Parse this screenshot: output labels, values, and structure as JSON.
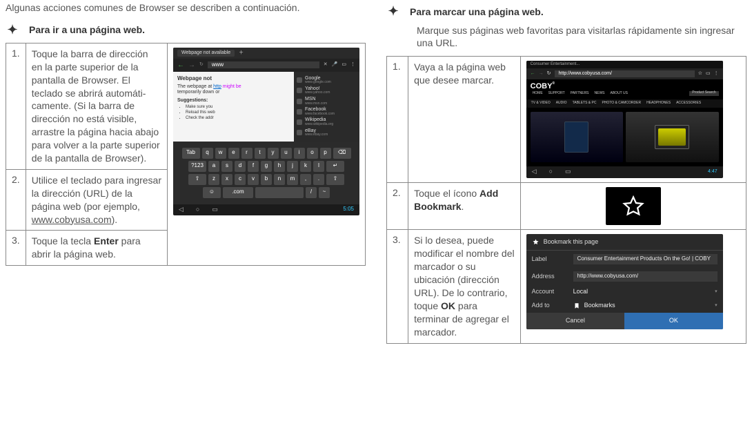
{
  "left": {
    "intro": "Algunas acciones comunes de Browser se describen a continuación.",
    "heading": "Para ir a una página web.",
    "steps": [
      {
        "num": "1.",
        "text": "Toque la barra de dirección en la parte superior de la pantalla de Browser. El teclado se abrirá automáti­camente. (Si la barra de dirección no está visible, arrastre la página hacia abajo para volver a la parte superior de la pantalla de Browser)."
      },
      {
        "num": "2.",
        "text_pre": "Utilice el teclado para ingresar la dirección (URL) de la página web (por ejemplo, ",
        "url": "www.cobyusa.com",
        "text_post": ")."
      },
      {
        "num": "3.",
        "text_pre": "Toque la tecla ",
        "bold": "Enter",
        "text_post": " para abrir la página web."
      }
    ]
  },
  "right": {
    "heading": "Para marcar una página web.",
    "subtext": "Marque sus páginas web favoritas para visitarlas rápidamente sin ingresar una URL.",
    "steps": [
      {
        "num": "1.",
        "text": "Vaya a la página web que desee marcar."
      },
      {
        "num": "2.",
        "text_pre": "Toque el ícono ",
        "bold": "Add Bookmark",
        "text_post": "."
      },
      {
        "num": "3.",
        "text_pre": "Si lo desea, puede modificar el nombre del marcador o su ubicación (direc­ción URL). De lo contrario, toque ",
        "bold": "OK",
        "text_post": " para terminar de agregar el marcador."
      }
    ]
  },
  "shot1": {
    "tab": "Webpage not available",
    "url_typed": "www",
    "page_title": "Webpage not ",
    "msg1": "The webpage at ",
    "http": "http",
    "msg2": " might be",
    "msg3": "temporarily down or",
    "sugg": "Suggestions:",
    "bul1": "Make sure you",
    "bul2": "Reload this web",
    "bul3": "Check the addr",
    "side": [
      "Google",
      "Yahoo!",
      "MSN",
      "Facebook",
      "Wikipedia",
      "eBay"
    ],
    "side_sub": [
      "www.google.com",
      "www.yahoo.com",
      "www.msn.com",
      "www.facebook.com",
      "www.wikipedia.org",
      "www.ebay.com"
    ],
    "kbd_rows": [
      [
        "Tab",
        "q",
        "w",
        "e",
        "r",
        "t",
        "y",
        "u",
        "i",
        "o",
        "p",
        "⌫"
      ],
      [
        "?123",
        "a",
        "s",
        "d",
        "f",
        "g",
        "h",
        "j",
        "k",
        "l",
        "↵"
      ],
      [
        "⇧",
        "z",
        "x",
        "c",
        "v",
        "b",
        "n",
        "m",
        ",",
        ".",
        "⇧"
      ],
      [
        "☺",
        ".com",
        "/",
        "~"
      ]
    ],
    "time": "5:05"
  },
  "shot2": {
    "top": "Consumer Entertainment...",
    "url": "http://www.cobyusa.com/",
    "logo": "COBY",
    "tm": "®",
    "menu1": [
      "HOME",
      "SUPPORT",
      "PARTNERS",
      "NEWS",
      "ABOUT US"
    ],
    "search": "Product Search",
    "menu2": [
      "TV & VIDEO",
      "AUDIO",
      "TABLETS & PC",
      "PHOTO & CAMCORDER",
      "HEADPHONES",
      "ACCESSORIES"
    ],
    "time": "4:47"
  },
  "shot4": {
    "title": "Bookmark this page",
    "rows": {
      "label_lab": "Label",
      "label_val": "Consumer Entertainment Products On the Go! | COBY",
      "addr_lab": "Address",
      "addr_val": "http://www.cobyusa.com/",
      "acct_lab": "Account",
      "acct_val": "Local",
      "addto_lab": "Add to",
      "addto_val": "Bookmarks"
    },
    "cancel": "Cancel",
    "ok": "OK"
  }
}
